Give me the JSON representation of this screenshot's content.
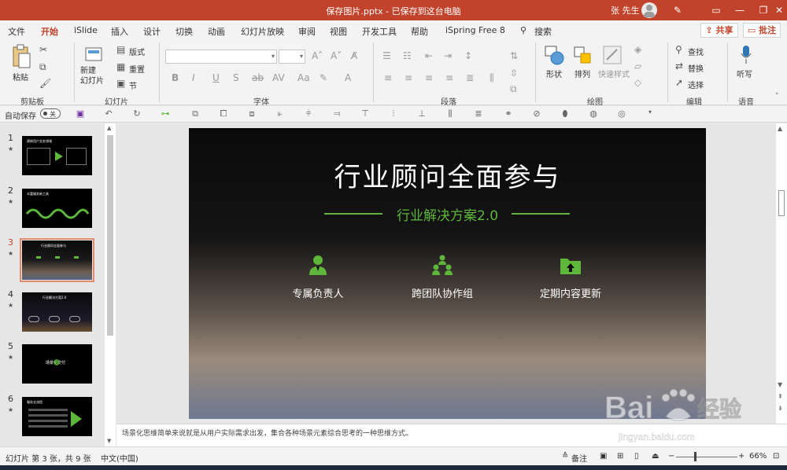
{
  "titlebar": {
    "doc_title": "保存图片.pptx  -  已保存到这台电脑",
    "user": "张 先生"
  },
  "menu": {
    "tabs": [
      "文件",
      "开始",
      "iSlide",
      "插入",
      "设计",
      "切换",
      "动画",
      "幻灯片放映",
      "审阅",
      "视图",
      "开发工具",
      "帮助",
      "iSpring Free 8"
    ],
    "active": "开始",
    "search": "搜索",
    "share": "共享",
    "comment": "批注"
  },
  "ribbon": {
    "groups": [
      "剪贴板",
      "幻灯片",
      "字体",
      "段落",
      "绘图",
      "编辑",
      "语音"
    ],
    "paste": "粘贴",
    "new_slide": "新建\n幻灯片",
    "layout": "版式",
    "reset": "重置",
    "section": "节",
    "shape": "形状",
    "arrange": "排列",
    "quick_style": "快速样式",
    "find": "查找",
    "replace": "替换",
    "select": "选择",
    "dictate": "听写"
  },
  "qat": {
    "autosave": "自动保存",
    "autosave_state": "关"
  },
  "thumbnails": [
    {
      "num": "1",
      "title": "建筑用户业务领域",
      "current": false
    },
    {
      "num": "2",
      "title": "丰富服务新工具",
      "current": false
    },
    {
      "num": "3",
      "title": "行业顾问全面参与",
      "current": true
    },
    {
      "num": "4",
      "title": "行业解决方案2.0",
      "current": false
    },
    {
      "num": "5",
      "title": "场景化交付",
      "current": false
    },
    {
      "num": "6",
      "title": "服务全流程",
      "current": false
    }
  ],
  "slide": {
    "title": "行业顾问全面参与",
    "subtitle": "行业解决方案2.0",
    "features": [
      {
        "label": "专属负责人",
        "icon": "consultant-icon"
      },
      {
        "label": "跨团队协作组",
        "icon": "team-icon"
      },
      {
        "label": "定期内容更新",
        "icon": "folder-upload-icon"
      }
    ],
    "accent_color": "#5eb63b"
  },
  "notes": {
    "text": "场景化思维简单来说就是从用户实际需求出发，集合各种场景元素综合思考的一种思维方式。"
  },
  "status": {
    "slide_info": "幻灯片 第 3 张，共 9 张",
    "language": "中文(中国)",
    "notes_btn": "备注",
    "zoom": "66%"
  },
  "watermark": {
    "brand": "Bai",
    "brand_cn": "经验",
    "url": "jingyan.baidu.com"
  },
  "colors": {
    "titlebar": "#c1432b",
    "ribbon_bg": "#f3f3f3"
  }
}
